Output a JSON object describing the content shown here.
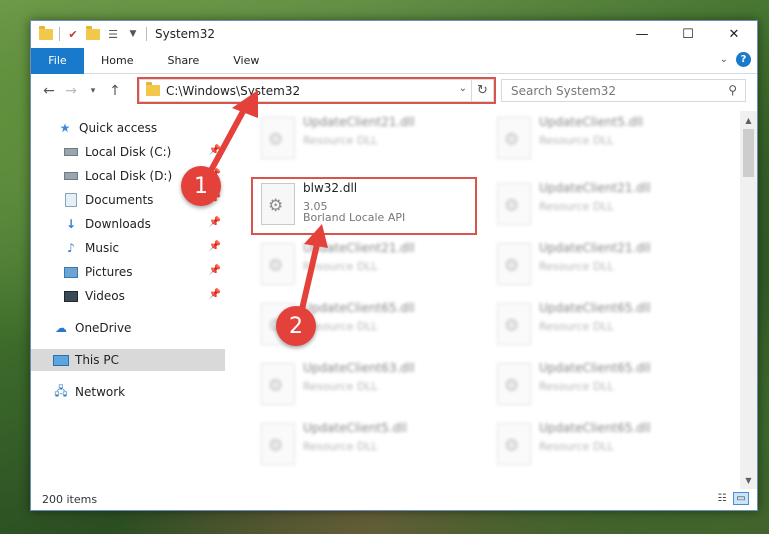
{
  "window": {
    "title": "System32",
    "controls": {
      "minimize": "—",
      "maximize": "☐",
      "close": "✕"
    }
  },
  "ribbon": {
    "tabs": [
      "File",
      "Home",
      "Share",
      "View"
    ],
    "help": "?"
  },
  "address_bar": {
    "path": "C:\\Windows\\System32"
  },
  "search": {
    "placeholder": "Search System32"
  },
  "sidebar": {
    "items": [
      {
        "label": "Quick access",
        "icon": "star-icon",
        "pinned": false
      },
      {
        "label": "Local Disk (C:)",
        "icon": "drive-icon",
        "pinned": true
      },
      {
        "label": "Local Disk (D:)",
        "icon": "drive-icon",
        "pinned": true
      },
      {
        "label": "Documents",
        "icon": "documents-icon",
        "pinned": true
      },
      {
        "label": "Downloads",
        "icon": "download-icon",
        "pinned": true
      },
      {
        "label": "Music",
        "icon": "music-icon",
        "pinned": true
      },
      {
        "label": "Pictures",
        "icon": "pictures-icon",
        "pinned": true
      },
      {
        "label": "Videos",
        "icon": "videos-icon",
        "pinned": true
      },
      {
        "label": "OneDrive",
        "icon": "cloud-icon",
        "pinned": false
      },
      {
        "label": "This PC",
        "icon": "computer-icon",
        "pinned": false,
        "selected": true
      },
      {
        "label": "Network",
        "icon": "network-icon",
        "pinned": false
      }
    ]
  },
  "files": {
    "highlighted": {
      "name": "blw32.dll",
      "version": "3.05",
      "description": "Borland Locale API"
    },
    "left_column": [
      {
        "name": "UpdateClient21.dll",
        "type": "Resource DLL"
      },
      {
        "name": "UpdateClient21.dll",
        "type": "Resource DLL"
      },
      {
        "name": "UpdateClient65.dll",
        "type": "Resource DLL"
      },
      {
        "name": "UpdateClient63.dll",
        "type": "Resource DLL"
      },
      {
        "name": "UpdateClient5.dll",
        "type": "Resource DLL"
      }
    ],
    "right_column": [
      {
        "name": "UpdateClient5.dll",
        "type": "Resource DLL"
      },
      {
        "name": "UpdateClient21.dll",
        "type": "Resource DLL"
      },
      {
        "name": "UpdateClient21.dll",
        "type": "Resource DLL"
      },
      {
        "name": "UpdateClient65.dll",
        "type": "Resource DLL"
      },
      {
        "name": "UpdateClient65.dll",
        "type": "Resource DLL"
      },
      {
        "name": "UpdateClient65.dll",
        "type": "Resource DLL"
      }
    ]
  },
  "status": {
    "item_count": "200 items"
  },
  "callouts": [
    "1",
    "2"
  ],
  "colors": {
    "accent": "#1979ca",
    "highlight": "#d9534f",
    "callout": "#e4413b"
  }
}
